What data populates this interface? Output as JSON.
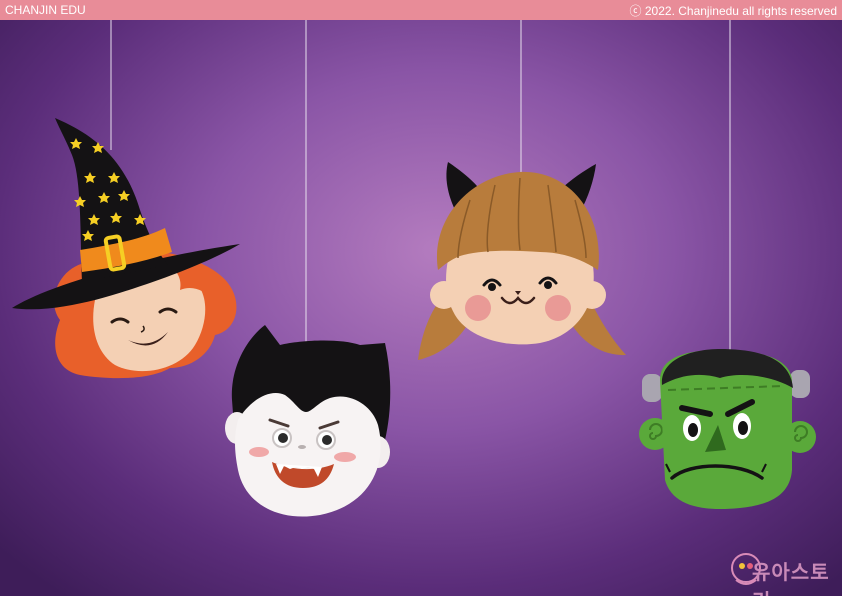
{
  "header": {
    "brand": "CHANJIN EDU",
    "copyright": "ⓒ 2022. Chanjinedu all rights reserved"
  },
  "watermark": {
    "text": "유아스토리"
  },
  "colors": {
    "banner": "#e88c98",
    "background": "#8a55a6",
    "witch_hair": "#e8602a",
    "hat": "#141214",
    "hat_band": "#f08a1c",
    "frankenstein_skin": "#5aa93a",
    "cat_hair": "#b87c3c"
  }
}
